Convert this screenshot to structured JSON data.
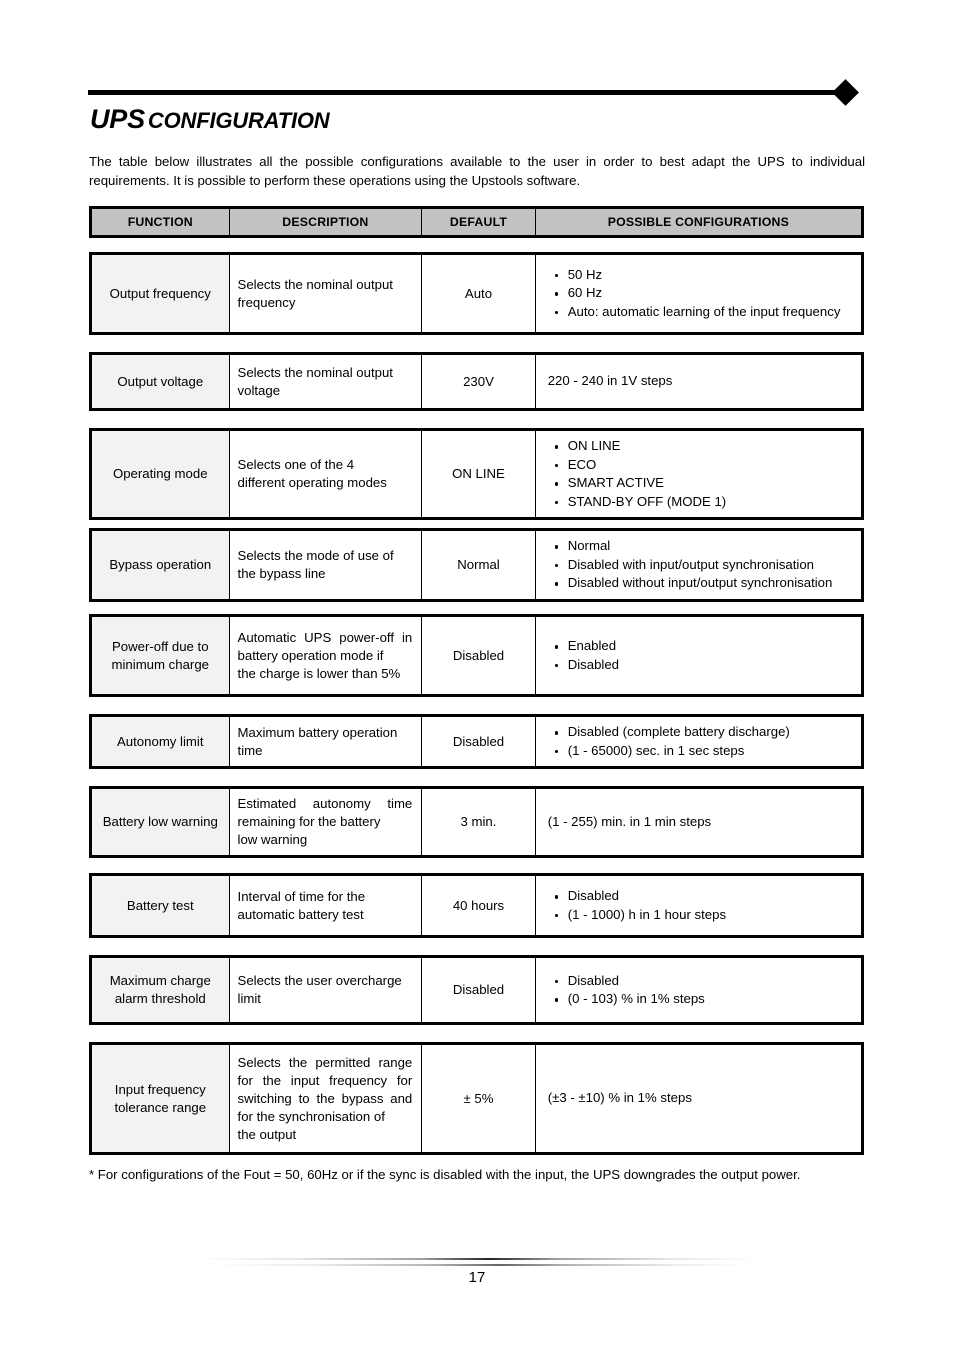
{
  "title": {
    "main": "UPS",
    "sub": "CONFIGURATION"
  },
  "intro": "The table below illustrates all the possible configurations available to the user in order to best adapt the UPS to individual requirements. It is possible to perform these operations using the Upstools software.",
  "table": {
    "headers": {
      "function": "FUNCTION",
      "description": "DESCRIPTION",
      "default": "DEFAULT",
      "configurations": "POSSIBLE CONFIGURATIONS"
    },
    "rows": [
      {
        "function": "Output frequency",
        "description": "Selects the nominal output",
        "description_last": "frequency",
        "default": "Auto",
        "configs": [
          "50 Hz",
          "60 Hz",
          "Auto: automatic learning of the input frequency"
        ]
      },
      {
        "function": "Output voltage",
        "description": "Selects the nominal output",
        "description_last": "voltage",
        "default": "230V",
        "configs_plain": "220 - 240 in 1V steps"
      },
      {
        "function": "Operating mode",
        "description": "Selects one of the 4",
        "description_last": "different operating modes",
        "default": "ON LINE",
        "configs": [
          "ON LINE",
          "ECO",
          "SMART ACTIVE",
          "STAND-BY OFF (MODE 1)"
        ]
      },
      {
        "function": "Bypass operation",
        "description": "Selects the mode of use of",
        "description_last": "the bypass line",
        "default": "Normal",
        "configs": [
          "Normal",
          "Disabled with input/output synchronisation",
          "Disabled without input/output synchronisation"
        ]
      },
      {
        "function": "Power-off due to minimum charge",
        "description": "Automatic UPS power-off in battery operation mode if",
        "description_last": "the charge is lower than 5%",
        "default": "Disabled",
        "configs": [
          "Enabled",
          "Disabled"
        ]
      },
      {
        "function": "Autonomy limit",
        "description": "Maximum battery operation",
        "description_last": "time",
        "default": "Disabled",
        "configs": [
          "Disabled (complete battery discharge)",
          "(1 - 65000) sec.  in 1 sec steps"
        ]
      },
      {
        "function": "Battery low warning",
        "description": "Estimated autonomy time remaining for the battery",
        "description_last": "low warning",
        "default": "3 min.",
        "configs_plain": "(1 - 255) min.  in 1 min steps"
      },
      {
        "function": "Battery test",
        "description": "Interval of time for the",
        "description_last": "automatic battery test",
        "default": "40 hours",
        "configs": [
          "Disabled",
          "(1 - 1000) h in 1 hour steps"
        ]
      },
      {
        "function": "Maximum charge alarm threshold",
        "description": "Selects the user overcharge",
        "description_last": "limit",
        "default": "Disabled",
        "configs": [
          "Disabled",
          "(0 - 103) %  in 1% steps"
        ]
      },
      {
        "function": "Input frequency tolerance range",
        "description": "Selects the permitted range for the input frequency for switching to the bypass and for the synchronisation of",
        "description_last": "the output",
        "default": "± 5%",
        "configs_plain": "(±3 - ±10) %  in 1% steps"
      }
    ]
  },
  "footnote": "* For configurations of the Fout = 50, 60Hz or if the sync is disabled with the input, the UPS downgrades the output power.",
  "footer": {
    "page_number": "17"
  },
  "colors": {
    "header_fill": "#c2c2c2",
    "function_fill": "#f2f2f2",
    "border": "#000000"
  }
}
